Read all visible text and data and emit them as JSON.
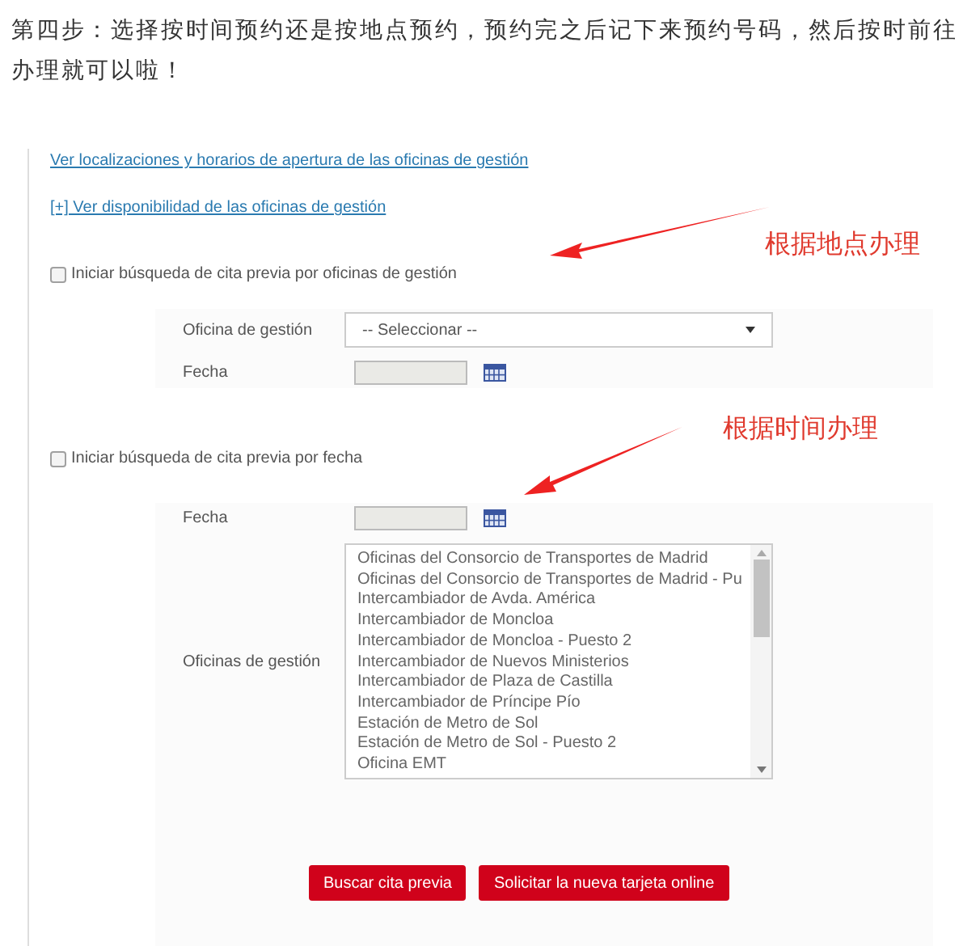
{
  "article_text": "第四步：选择按时间预约还是按地点预约，预约完之后记下来预约号码，然后按时前往办理就可以啦！",
  "form": {
    "links": [
      "Ver localizaciones y horarios de apertura de las oficinas de gestión",
      "[+] Ver disponibilidad de las oficinas de gestión"
    ],
    "search_by_office": {
      "label": "Iniciar búsqueda de cita previa por oficinas de gestión",
      "checked": false,
      "office_label": "Oficina de gestión",
      "office_select": "-- Seleccionar --",
      "date_label": "Fecha"
    },
    "search_by_date": {
      "label": "Iniciar búsqueda de cita previa por fecha",
      "checked": false,
      "date_label": "Fecha",
      "offices_label": "Oficinas de gestión",
      "offices": [
        "Oficinas del Consorcio de Transportes de Madrid",
        "Oficinas del Consorcio de Transportes de Madrid - Pu",
        "Intercambiador de Avda. América",
        "Intercambiador de Moncloa",
        "Intercambiador de Moncloa - Puesto 2",
        "Intercambiador de Nuevos Ministerios",
        "Intercambiador de Plaza de Castilla",
        "Intercambiador de Príncipe Pío",
        "Estación de Metro de Sol",
        "Estación de Metro de Sol - Puesto 2",
        "Oficina EMT"
      ]
    },
    "buttons": [
      "Buscar cita previa",
      "Solicitar la nueva tarjeta online"
    ]
  },
  "annotations": [
    "根据地点办理",
    "根据时间办理"
  ]
}
